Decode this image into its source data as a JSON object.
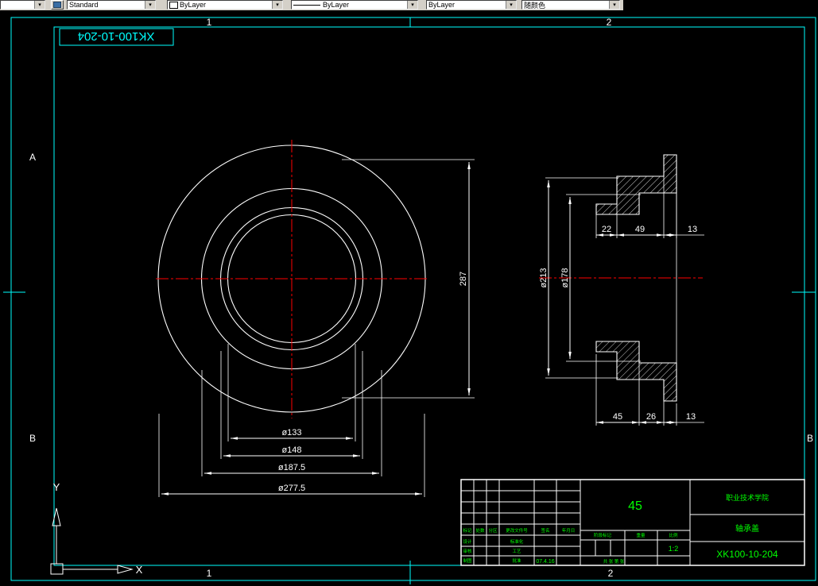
{
  "toolbar": {
    "combos": [
      {
        "value": ""
      },
      {
        "value": "Standard"
      },
      {
        "value": "ByLayer"
      },
      {
        "value": "ByLayer"
      },
      {
        "value": "ByLayer"
      },
      {
        "value": "随颜色"
      }
    ]
  },
  "frame": {
    "corner_label": "XK100-10-204",
    "zones": {
      "top1": "1",
      "top2": "2",
      "bottom1": "1",
      "bottom2": "2",
      "leftA": "A",
      "leftB": "B",
      "rightB": "B"
    }
  },
  "front_view": {
    "dim_vertical": "287",
    "dim_d1": "ø133",
    "dim_d2": "ø148",
    "dim_d3": "ø187.5",
    "dim_d4": "ø277.5"
  },
  "section_view": {
    "dim_od": "ø213",
    "dim_bore": "ø178",
    "top_dims": [
      "22",
      "49",
      "13"
    ],
    "bottom_dims": [
      "45",
      "26",
      "13"
    ]
  },
  "title_block": {
    "material": "45",
    "scale": "1:2",
    "drawing_number": "XK100-10-204",
    "date": "07.4.16",
    "company": "职业技术学院",
    "part_name": "轴承盖",
    "labels": {
      "mark": "标记",
      "count": "处数",
      "zone": "分区",
      "doc_no": "更改文件号",
      "sign": "签名",
      "date_col": "年月日",
      "design": "设计",
      "standard": "标准化",
      "check": "审核",
      "process": "工艺",
      "draw": "制图",
      "approve": "批准",
      "stage": "阶段标记",
      "weight": "重量",
      "scale_label": "比例",
      "sheet": "共 张 第 张"
    }
  },
  "ucs": {
    "x_label": "X",
    "y_label": "Y"
  }
}
